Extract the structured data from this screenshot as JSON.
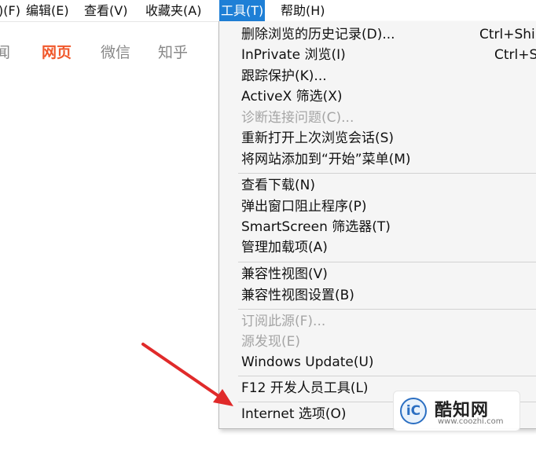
{
  "menubar": {
    "items": [
      {
        "label": ")(F)"
      },
      {
        "label": "编辑(E)"
      },
      {
        "label": "查看(V)"
      },
      {
        "label": "收藏夹(A)"
      },
      {
        "label": "工具(T)"
      },
      {
        "label": "帮助(H)"
      }
    ]
  },
  "tabs": [
    "闻",
    "网页",
    "微信",
    "知乎"
  ],
  "dropdown": {
    "items": [
      {
        "label": "删除浏览的历史记录(D)...",
        "shortcut": "Ctrl+Shi"
      },
      {
        "label": "InPrivate 浏览(I)",
        "shortcut": "Ctrl+S"
      },
      {
        "label": "跟踪保护(K)..."
      },
      {
        "label": "ActiveX 筛选(X)"
      },
      {
        "label": "诊断连接问题(C)..."
      },
      {
        "label": "重新打开上次浏览会话(S)"
      },
      {
        "label": "将网站添加到“开始”菜单(M)"
      },
      {
        "label": "查看下载(N)"
      },
      {
        "label": "弹出窗口阻止程序(P)"
      },
      {
        "label": "SmartScreen 筛选器(T)"
      },
      {
        "label": "管理加载项(A)"
      },
      {
        "label": "兼容性视图(V)"
      },
      {
        "label": "兼容性视图设置(B)"
      },
      {
        "label": "订阅此源(F)..."
      },
      {
        "label": "源发现(E)"
      },
      {
        "label": "Windows Update(U)"
      },
      {
        "label": "F12 开发人员工具(L)"
      },
      {
        "label": "Internet 选项(O)"
      }
    ]
  },
  "watermark": {
    "logo": "iC",
    "name": "酷知网",
    "url": "www.coozhi.com"
  },
  "colors": {
    "menu_highlight": "#1e7fd6",
    "active_tab": "#f0582b",
    "arrow": "#e02a2a"
  }
}
